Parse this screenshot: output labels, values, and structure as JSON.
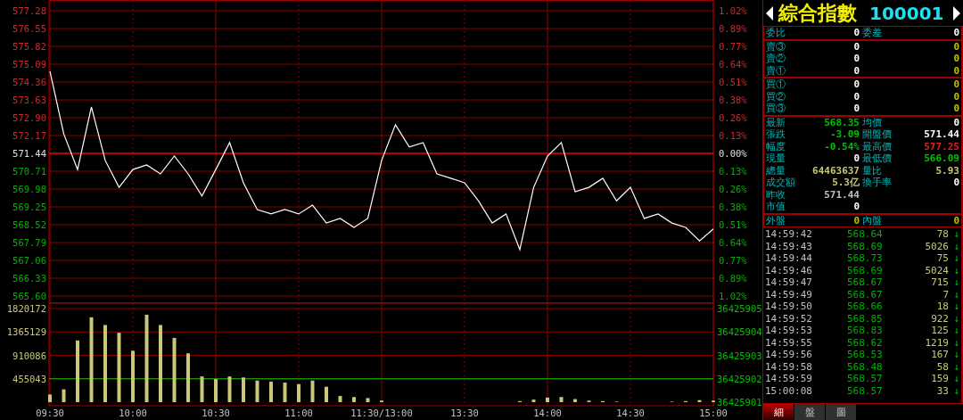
{
  "price_chart": {
    "chart_data": {
      "type": "line",
      "grid": true,
      "ylim": [
        565.6,
        577.28
      ],
      "yticks": [
        {
          "value": 577.28,
          "label": "577.28"
        },
        {
          "value": 576.55,
          "label": "576.55"
        },
        {
          "value": 575.82,
          "label": "575.82"
        },
        {
          "value": 575.09,
          "label": "575.09"
        },
        {
          "value": 574.36,
          "label": "574.36"
        },
        {
          "value": 573.63,
          "label": "573.63"
        },
        {
          "value": 572.9,
          "label": "572.90"
        },
        {
          "value": 572.17,
          "label": "572.17"
        },
        {
          "value": 571.44,
          "label": "571.44"
        },
        {
          "value": 570.71,
          "label": "570.71"
        },
        {
          "value": 569.98,
          "label": "569.98"
        },
        {
          "value": 569.25,
          "label": "569.25"
        },
        {
          "value": 568.52,
          "label": "568.52"
        },
        {
          "value": 567.79,
          "label": "567.79"
        },
        {
          "value": 567.06,
          "label": "567.06"
        },
        {
          "value": 566.33,
          "label": "566.33"
        },
        {
          "value": 565.6,
          "label": "565.60"
        }
      ],
      "ref_lines": [
        {
          "axis": "y",
          "value": 571.44,
          "color": "#e00000"
        }
      ],
      "series": [
        {
          "color": "#ffffff",
          "values": [
            574.8,
            572.24,
            570.78,
            573.34,
            571.15,
            570.05,
            570.78,
            570.97,
            570.6,
            571.33,
            570.6,
            569.69,
            570.78,
            571.88,
            570.24,
            569.14,
            568.96,
            569.14,
            568.96,
            569.32,
            568.59,
            568.78,
            568.41,
            568.78,
            571.15,
            572.61,
            571.7,
            571.88,
            570.6,
            570.42,
            570.24,
            569.5,
            568.59,
            568.96,
            567.5,
            570.05,
            571.33,
            571.88,
            569.87,
            570.05,
            570.42,
            569.5,
            570.05,
            568.78,
            568.96,
            568.59,
            568.41,
            567.86,
            568.35
          ]
        }
      ]
    },
    "right_axis": [
      "1.02%",
      "0.89%",
      "0.77%",
      "0.64%",
      "0.51%",
      "0.38%",
      "0.26%",
      "0.13%",
      "0.00%",
      "0.13%",
      "0.26%",
      "0.38%",
      "0.51%",
      "0.64%",
      "0.77%",
      "0.89%",
      "1.02%"
    ]
  },
  "volume_chart": {
    "chart_data": {
      "type": "bar",
      "grid": true,
      "categories": [
        "09:30",
        null,
        null,
        null,
        null,
        null,
        "10:00",
        null,
        null,
        null,
        null,
        null,
        "10:30",
        null,
        null,
        null,
        null,
        null,
        "11:00",
        null,
        null,
        null,
        null,
        null,
        "11:30/13:00",
        null,
        null,
        null,
        null,
        null,
        "13:30",
        null,
        null,
        null,
        null,
        null,
        "14:00",
        null,
        null,
        null,
        null,
        null,
        "14:30",
        null,
        null,
        null,
        null,
        null,
        "15:00"
      ],
      "ylim": [
        0,
        1820172
      ],
      "yticks": [
        {
          "value": 1820172,
          "label": "1820172"
        },
        {
          "value": 1365129,
          "label": "1365129"
        },
        {
          "value": 910086,
          "label": "910086"
        },
        {
          "value": 455043,
          "label": "455043"
        }
      ],
      "ref_lines": [
        {
          "axis": "y",
          "value": 455043,
          "color": "#00c000"
        }
      ],
      "series": [
        {
          "color": "#c8c878",
          "values": [
            150000,
            250000,
            1200000,
            1650000,
            1500000,
            1350000,
            1000000,
            1700000,
            1500000,
            1250000,
            950000,
            500000,
            450000,
            500000,
            480000,
            420000,
            400000,
            380000,
            350000,
            420000,
            300000,
            120000,
            100000,
            80000,
            30000,
            0,
            0,
            0,
            0,
            0,
            0,
            0,
            0,
            0,
            20000,
            50000,
            90000,
            100000,
            60000,
            30000,
            20000,
            10000,
            0,
            0,
            0,
            10000,
            20000,
            40000,
            30000
          ]
        }
      ]
    },
    "right_axis": [
      "36425905",
      "36425904",
      "36425903",
      "36425902",
      "36425901"
    ]
  },
  "quote": {
    "name": "綜合指數",
    "code": "100001",
    "sections": [
      [
        {
          "left": {
            "label": "委比",
            "value": "0",
            "color": "#ffffff"
          },
          "right": {
            "label": "委差",
            "value": "0",
            "color": "#ffffff"
          }
        }
      ],
      [
        {
          "left": {
            "label": "賣③",
            "value": "0",
            "color": "#ffffff"
          },
          "right": {
            "value": "0",
            "color": "#c0c000"
          }
        },
        {
          "left": {
            "label": "賣②",
            "value": "0",
            "color": "#ffffff"
          },
          "right": {
            "value": "0",
            "color": "#c0c000"
          }
        },
        {
          "left": {
            "label": "賣①",
            "value": "0",
            "color": "#ffffff"
          },
          "right": {
            "value": "0",
            "color": "#c0c000"
          }
        }
      ],
      [
        {
          "left": {
            "label": "買①",
            "value": "0",
            "color": "#ffffff"
          },
          "right": {
            "value": "0",
            "color": "#c0c000"
          }
        },
        {
          "left": {
            "label": "買②",
            "value": "0",
            "color": "#ffffff"
          },
          "right": {
            "value": "0",
            "color": "#c0c000"
          }
        },
        {
          "left": {
            "label": "買③",
            "value": "0",
            "color": "#ffffff"
          },
          "right": {
            "value": "0",
            "color": "#c0c000"
          }
        }
      ],
      [
        {
          "left": {
            "label": "最新",
            "value": "568.35",
            "color": "#00c000"
          },
          "right": {
            "label": "均價",
            "value": "0",
            "color": "#ffffff"
          }
        },
        {
          "left": {
            "label": "張跌",
            "value": "-3.09",
            "color": "#00c000"
          },
          "right": {
            "label": "開盤價",
            "value": "571.44",
            "color": "#ffffff"
          }
        },
        {
          "left": {
            "label": "幅度",
            "value": "-0.54%",
            "color": "#00c000"
          },
          "right": {
            "label": "最高價",
            "value": "577.25",
            "color": "#e02020"
          }
        },
        {
          "left": {
            "label": "現量",
            "value": "0",
            "color": "#ffffff"
          },
          "right": {
            "label": "最低價",
            "value": "566.09",
            "color": "#00c000"
          }
        },
        {
          "left": {
            "label": "總量",
            "value": "64463637",
            "color": "#c8c878"
          },
          "right": {
            "label": "量比",
            "value": "5.93",
            "color": "#c8c878"
          }
        },
        {
          "left": {
            "label": "成交額",
            "value": "5.3亿",
            "color": "#c8c878"
          },
          "right": {
            "label": "換手率",
            "value": "0",
            "color": "#ffffff"
          }
        },
        {
          "left": {
            "label": "昨收",
            "value": "571.44",
            "color": "#c0c0c0"
          }
        },
        {
          "left": {
            "label": "市值",
            "value": "0",
            "color": "#ffffff"
          }
        }
      ],
      [
        {
          "left": {
            "label": "外盤",
            "value": "0",
            "color": "#c0c000"
          },
          "right": {
            "label": "內盤",
            "value": "0",
            "color": "#c0c000"
          }
        }
      ]
    ],
    "ticks": [
      {
        "time": "14:59:42",
        "price": "568.64",
        "volume": "78",
        "arrow": "↓"
      },
      {
        "time": "14:59:43",
        "price": "568.69",
        "volume": "5026",
        "arrow": "↓"
      },
      {
        "time": "14:59:44",
        "price": "568.73",
        "volume": "75",
        "arrow": "↓"
      },
      {
        "time": "14:59:46",
        "price": "568.69",
        "volume": "5024",
        "arrow": "↓"
      },
      {
        "time": "14:59:47",
        "price": "568.67",
        "volume": "715",
        "arrow": "↓"
      },
      {
        "time": "14:59:49",
        "price": "568.67",
        "volume": "7",
        "arrow": "↓"
      },
      {
        "time": "14:59:50",
        "price": "568.66",
        "volume": "18",
        "arrow": "↓"
      },
      {
        "time": "14:59:52",
        "price": "568.85",
        "volume": "922",
        "arrow": "↓"
      },
      {
        "time": "14:59:53",
        "price": "568.83",
        "volume": "125",
        "arrow": "↓"
      },
      {
        "time": "14:59:55",
        "price": "568.62",
        "volume": "1219",
        "arrow": "↓"
      },
      {
        "time": "14:59:56",
        "price": "568.53",
        "volume": "167",
        "arrow": "↓"
      },
      {
        "time": "14:59:58",
        "price": "568.48",
        "volume": "58",
        "arrow": "↓"
      },
      {
        "time": "14:59:59",
        "price": "568.57",
        "volume": "159",
        "arrow": "↓"
      },
      {
        "time": "15:00:08",
        "price": "568.57",
        "volume": "33",
        "arrow": "↓"
      }
    ],
    "tabs": [
      {
        "label": "細",
        "selected": true
      },
      {
        "label": "盤",
        "selected": false
      },
      {
        "label": "圖",
        "selected": false
      }
    ]
  }
}
